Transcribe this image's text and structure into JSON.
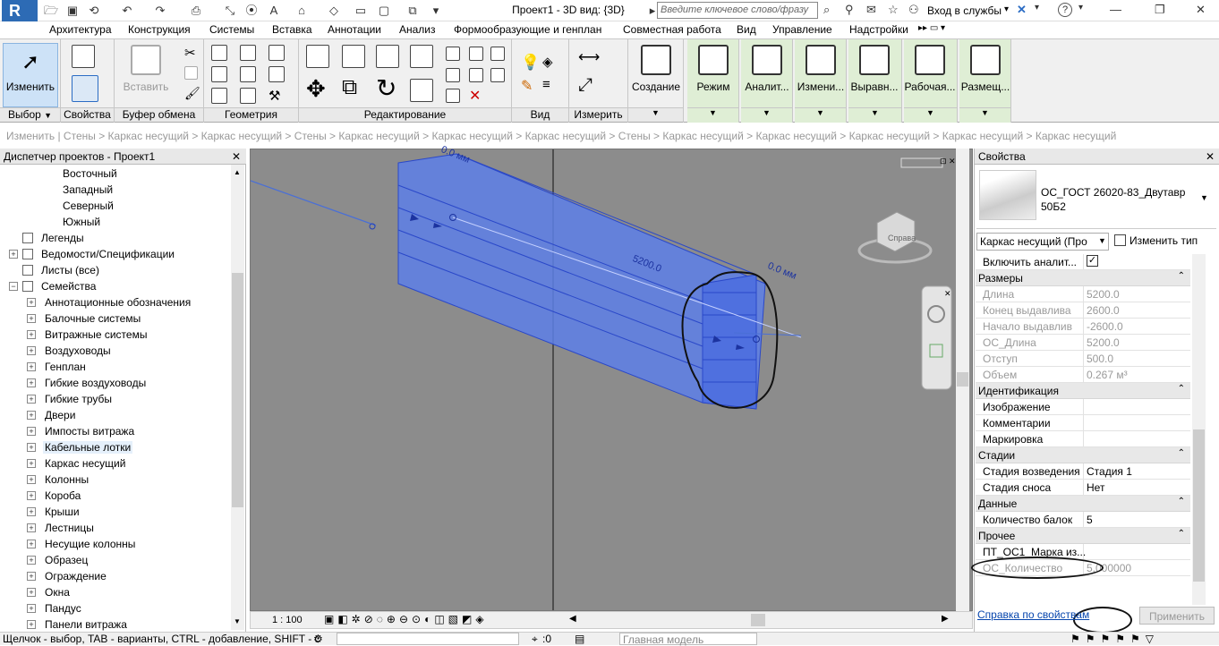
{
  "titlebar": {
    "app_logo": "R",
    "title": "Проект1 - 3D вид: {3D}",
    "search_placeholder": "Введите ключевое слово/фразу",
    "signin": "Вход в службы",
    "signin_caret": "▾",
    "help": "?",
    "minimize": "—",
    "restore": "❐",
    "close": "✕"
  },
  "tabs": [
    "Архитектура",
    "Конструкция",
    "Системы",
    "Вставка",
    "Аннотации",
    "Анализ",
    "Формообразующие и генплан",
    "Совместная работа",
    "Вид",
    "Управление",
    "Надстройки"
  ],
  "tabs_extra": "▸▸ ▭ ▾",
  "ribbon": {
    "modify_label": "Изменить",
    "paste_label": "Вставить",
    "create_label": "Создание",
    "green_buttons": [
      "Режим",
      "Аналит...",
      "Измени...",
      "Выравн...",
      "Рабочая...",
      "Размещ..."
    ],
    "panels": {
      "select": "Выбор",
      "properties": "Свойства",
      "clipboard": "Буфер обмена",
      "geometry": "Геометрия",
      "modify": "Редактирование",
      "view": "Вид",
      "measure": "Измерить"
    },
    "dropdown": "▼"
  },
  "breadcrumb": "Изменить | Стены > Каркас несущий > Каркас несущий > Стены > Каркас несущий > Каркас несущий > Каркас несущий > Стены > Каркас несущий > Каркас несущий > Каркас несущий > Каркас несущий > Каркас несущий",
  "browser": {
    "title": "Диспетчер проектов - Проект1",
    "close": "✕",
    "items": [
      {
        "label": "Восточный",
        "level": 3,
        "toggle": ""
      },
      {
        "label": "Западный",
        "level": 3,
        "toggle": ""
      },
      {
        "label": "Северный",
        "level": 3,
        "toggle": ""
      },
      {
        "label": "Южный",
        "level": 3,
        "toggle": ""
      },
      {
        "label": "Легенды",
        "level": 1,
        "toggle": ""
      },
      {
        "label": "Ведомости/Спецификации",
        "level": 1,
        "toggle": "+"
      },
      {
        "label": "Листы (все)",
        "level": 1,
        "toggle": ""
      },
      {
        "label": "Семейства",
        "level": 1,
        "toggle": "−"
      },
      {
        "label": "Аннотационные обозначения",
        "level": 2,
        "toggle": "+"
      },
      {
        "label": "Балочные системы",
        "level": 2,
        "toggle": "+"
      },
      {
        "label": "Витражные системы",
        "level": 2,
        "toggle": "+"
      },
      {
        "label": "Воздуховоды",
        "level": 2,
        "toggle": "+"
      },
      {
        "label": "Генплан",
        "level": 2,
        "toggle": "+"
      },
      {
        "label": "Гибкие воздуховоды",
        "level": 2,
        "toggle": "+"
      },
      {
        "label": "Гибкие трубы",
        "level": 2,
        "toggle": "+"
      },
      {
        "label": "Двери",
        "level": 2,
        "toggle": "+"
      },
      {
        "label": "Импосты витража",
        "level": 2,
        "toggle": "+"
      },
      {
        "label": "Кабельные лотки",
        "level": 2,
        "toggle": "+",
        "selected": true
      },
      {
        "label": "Каркас несущий",
        "level": 2,
        "toggle": "+"
      },
      {
        "label": "Колонны",
        "level": 2,
        "toggle": "+"
      },
      {
        "label": "Короба",
        "level": 2,
        "toggle": "+"
      },
      {
        "label": "Крыши",
        "level": 2,
        "toggle": "+"
      },
      {
        "label": "Лестницы",
        "level": 2,
        "toggle": "+"
      },
      {
        "label": "Несущие колонны",
        "level": 2,
        "toggle": "+"
      },
      {
        "label": "Образец",
        "level": 2,
        "toggle": "+"
      },
      {
        "label": "Ограждение",
        "level": 2,
        "toggle": "+"
      },
      {
        "label": "Окна",
        "level": 2,
        "toggle": "+"
      },
      {
        "label": "Пандус",
        "level": 2,
        "toggle": "+"
      },
      {
        "label": "Панели витража",
        "level": 2,
        "toggle": "+"
      }
    ]
  },
  "view": {
    "dim_top": "0.0 мм",
    "dim_mid": "5200.0",
    "dim_right": "0.0 мм",
    "viewcube_label": "Справа",
    "scale": "1 : 100"
  },
  "properties": {
    "title": "Свойства",
    "close": "✕",
    "type_name_line1": "ОС_ГОСТ 26020-83_Двутавр",
    "type_name_line2": "50Б2",
    "filter_value": "Каркас несущий (Про",
    "edit_type": "Изменить тип",
    "analytical_label": "Включить аналит...",
    "analytical_checked": "✓",
    "sections": {
      "dimensions": "Размеры",
      "identity": "Идентификация",
      "phasing": "Стадии",
      "data": "Данные",
      "other": "Прочее"
    },
    "collapse": "⌃",
    "dim_rows": [
      {
        "k": "Длина",
        "v": "5200.0"
      },
      {
        "k": "Конец выдавлива",
        "v": "2600.0"
      },
      {
        "k": "Начало выдавлив",
        "v": "-2600.0"
      },
      {
        "k": "ОС_Длина",
        "v": "5200.0"
      },
      {
        "k": "Отступ",
        "v": "500.0"
      },
      {
        "k": "Объем",
        "v": "0.267 м³"
      }
    ],
    "id_rows": [
      {
        "k": "Изображение",
        "v": ""
      },
      {
        "k": "Комментарии",
        "v": ""
      },
      {
        "k": "Маркировка",
        "v": ""
      }
    ],
    "phase_rows": [
      {
        "k": "Стадия возведения",
        "v": "Стадия 1"
      },
      {
        "k": "Стадия сноса",
        "v": "Нет"
      }
    ],
    "data_rows": [
      {
        "k": "Количество балок",
        "v": "5"
      }
    ],
    "other_rows": [
      {
        "k": "ПТ_ОС1_Марка из...",
        "v": ""
      },
      {
        "k": "ОС_Количество",
        "v": "5.000000"
      }
    ],
    "help_link": "Справка по свойствам",
    "apply": "Применить"
  },
  "status": {
    "hint": "Щелчок - выбор, TAB - варианты, CTRL - добавление, SHIFT - с",
    "count": ":0",
    "model": "Главная модель"
  },
  "colors": {
    "accent": "#2b6cc4",
    "beam": "#3d63d9",
    "green_panel": "#dfeed5"
  }
}
